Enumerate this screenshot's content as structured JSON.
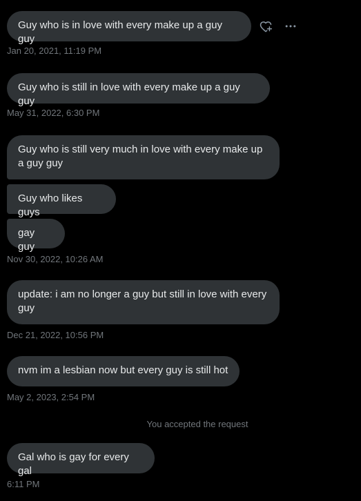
{
  "messages": [
    {
      "text": "Guy who is in love with every make up a guy guy"
    },
    {
      "text": "Guy who is still in love with every make up a guy guy"
    },
    {
      "text": "Guy who is still very much in love with every make up a guy guy"
    },
    {
      "text": "Guy who likes guys"
    },
    {
      "text": "gay guy"
    },
    {
      "text": "update: i am no longer a guy but still in love with every guy"
    },
    {
      "text": "nvm im a lesbian now but every guy is still hot"
    },
    {
      "text": "Gal who is gay for every gal"
    }
  ],
  "timestamps": [
    "Jan 20, 2021, 11:19 PM",
    "May 31, 2022, 6:30 PM",
    "Nov 30, 2022, 10:26 AM",
    "Dec 21, 2022, 10:56 PM",
    "May 2, 2023, 2:54 PM",
    "6:11 PM"
  ],
  "system_notice": "You accepted the request",
  "actions": {
    "react_icon": "heart-plus-icon",
    "more_icon": "more-horizontal-icon"
  },
  "colors": {
    "background": "#000000",
    "bubble": "#2f3336",
    "text": "#e7e9ea",
    "muted": "#71767b"
  }
}
